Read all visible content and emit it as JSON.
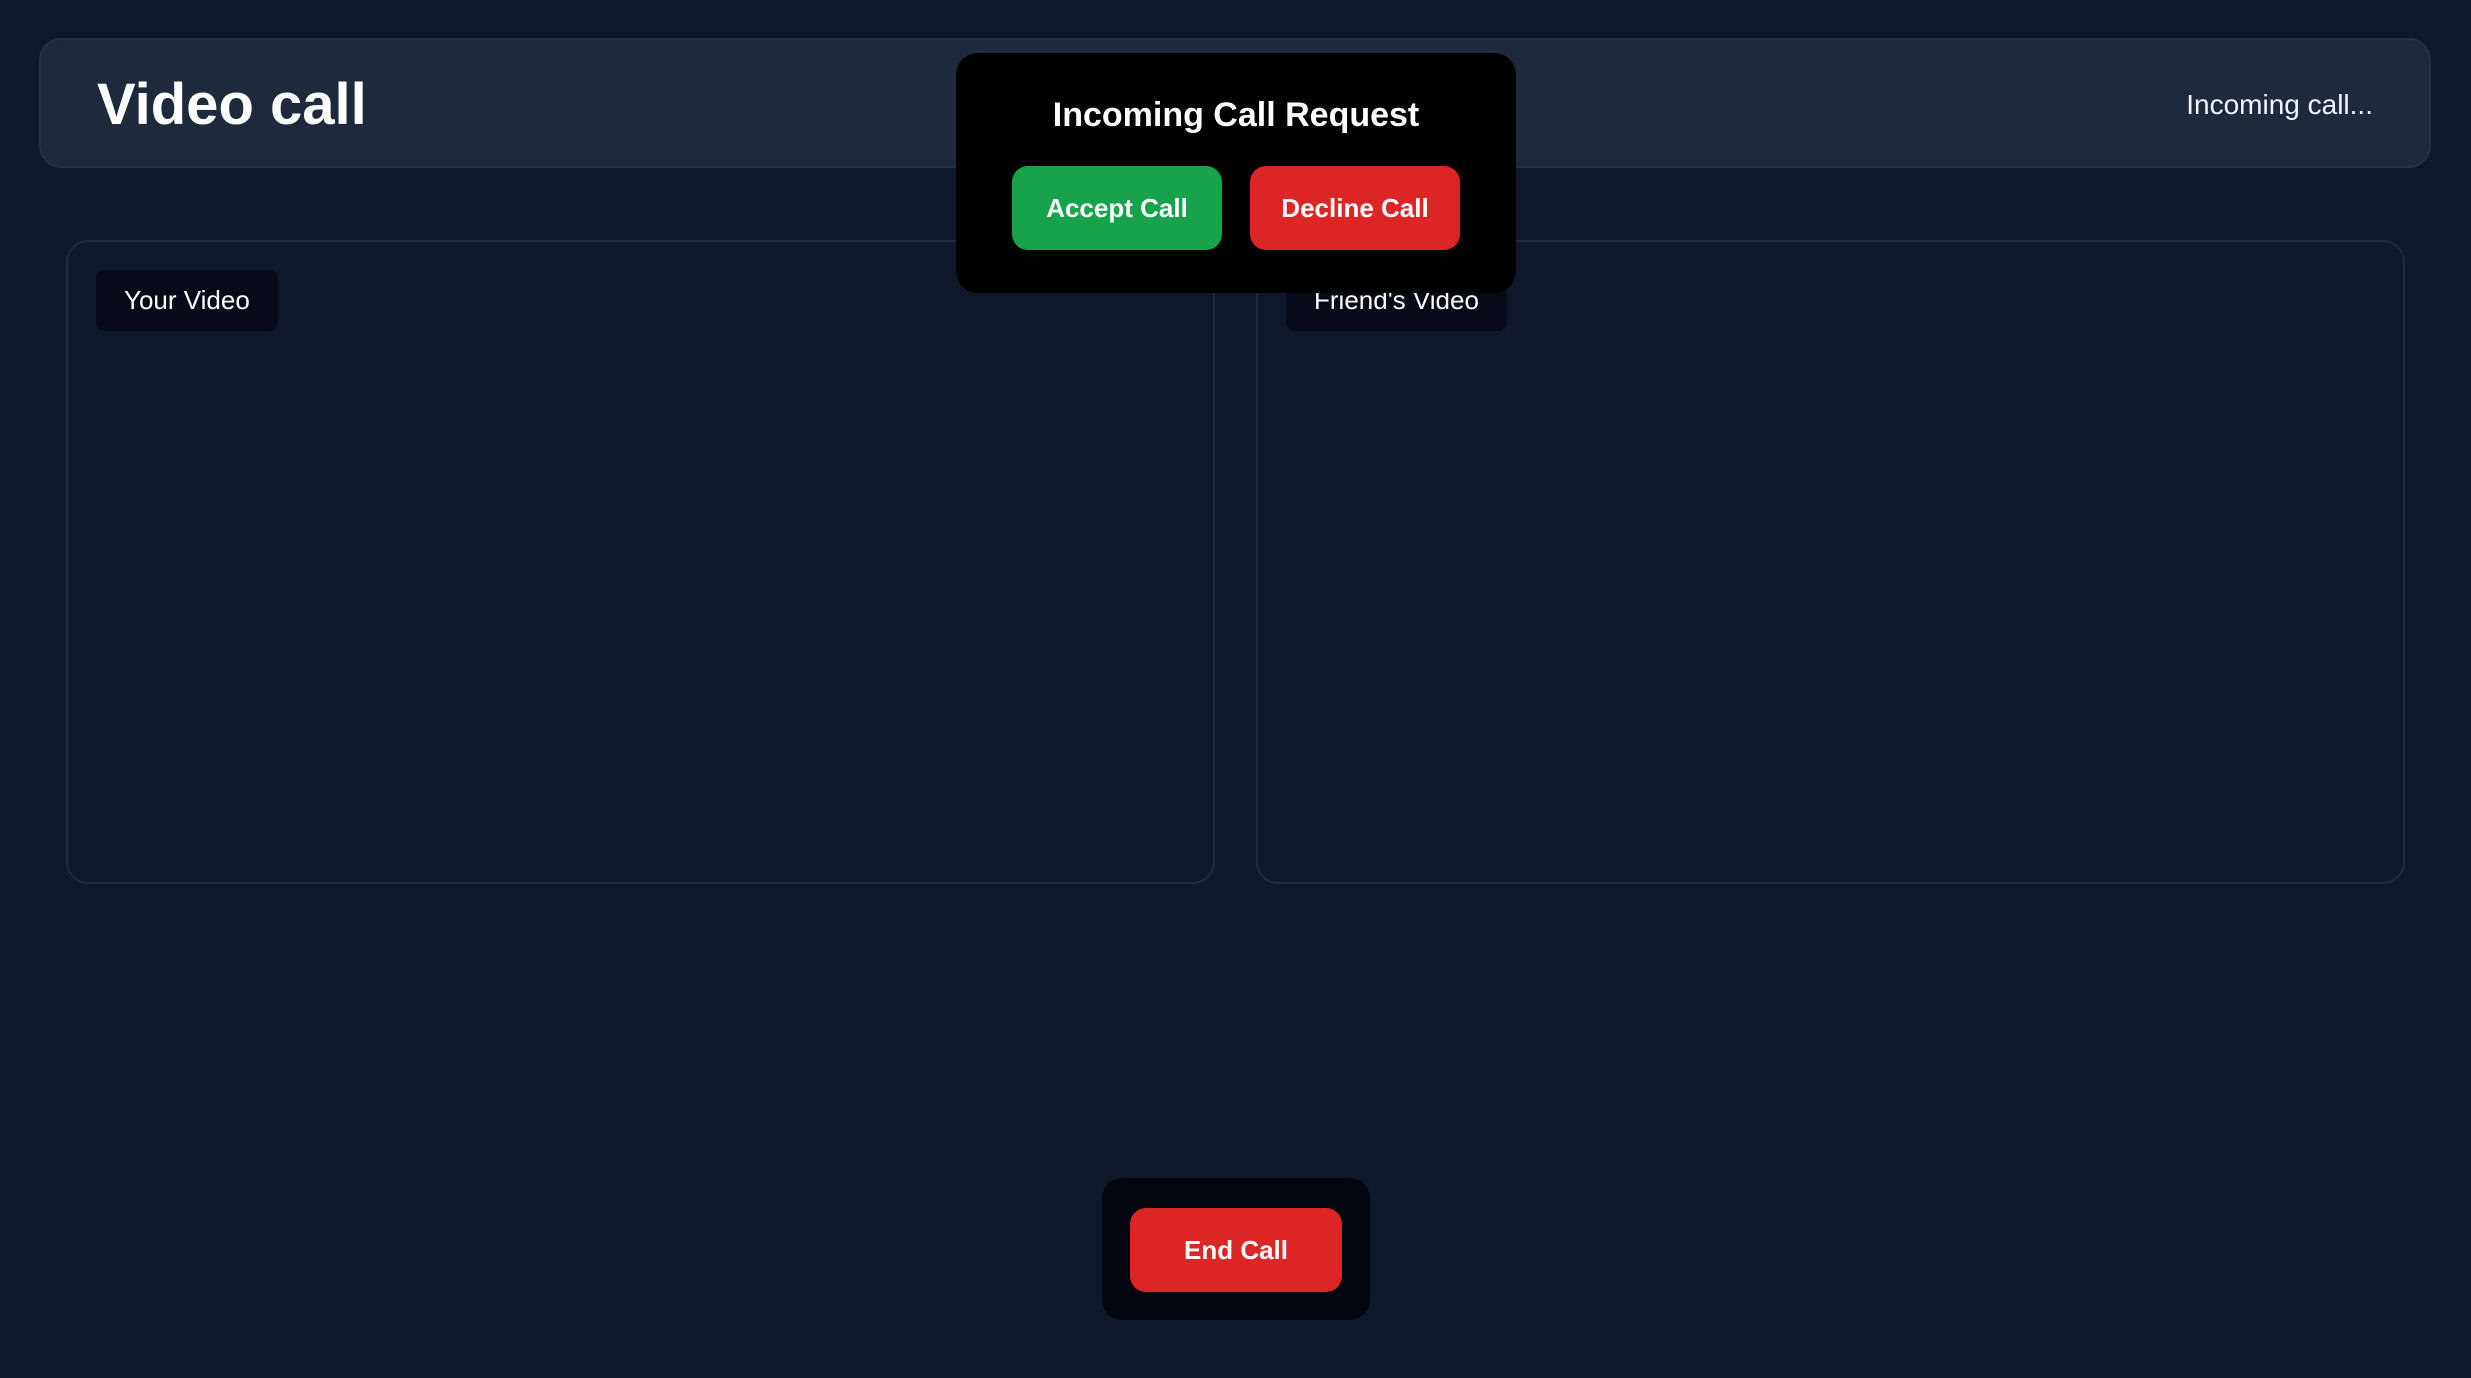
{
  "header": {
    "title": "Video call",
    "status": "Incoming call..."
  },
  "videos": {
    "local_label": "Your Video",
    "remote_label": "Friend's Video"
  },
  "incoming_call": {
    "title": "Incoming Call Request",
    "accept_label": "Accept Call",
    "decline_label": "Decline Call"
  },
  "controls": {
    "end_label": "End Call"
  },
  "colors": {
    "background": "#0f172a",
    "header_bg": "#1e293b",
    "accept": "#16a34a",
    "decline": "#dc2626",
    "end": "#dc2626"
  }
}
